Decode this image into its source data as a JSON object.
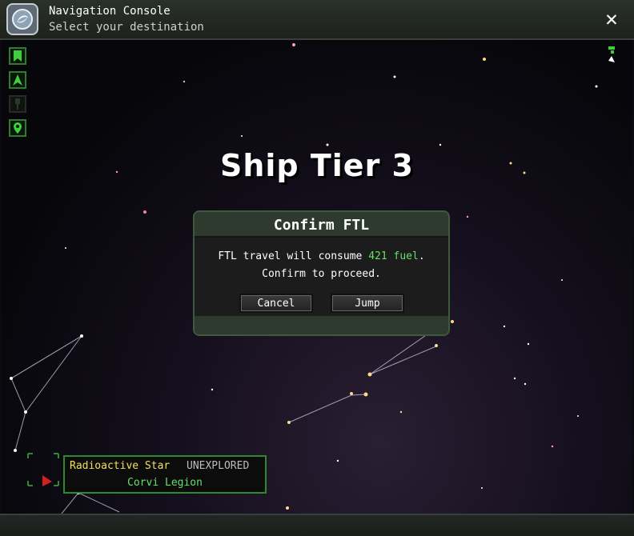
{
  "window": {
    "title": "Navigation Console",
    "subtitle": "Select your destination",
    "close_label": "✕"
  },
  "icons": {
    "app": "navigation-compass-icon",
    "close": "close-icon",
    "sidebar": [
      "bookmark-icon",
      "ship-icon",
      "beacon-icon",
      "map-pin-icon"
    ],
    "top_right": "player-ship-indicator-icon"
  },
  "map": {
    "heading": "Ship Tier 3"
  },
  "dialog": {
    "title": "Confirm FTL",
    "message_prefix": "FTL travel will consume ",
    "fuel_amount": "421 fuel",
    "message_suffix": ".",
    "message_line2": "Confirm to proceed.",
    "cancel_label": "Cancel",
    "jump_label": "Jump"
  },
  "tooltip": {
    "star_name": "Radioactive Star",
    "status": "UNEXPLORED",
    "faction": "Corvi Legion"
  },
  "colors": {
    "accent_green": "#68e068",
    "border_green": "#2f8a2f",
    "star_name_yellow": "#f0e060"
  }
}
